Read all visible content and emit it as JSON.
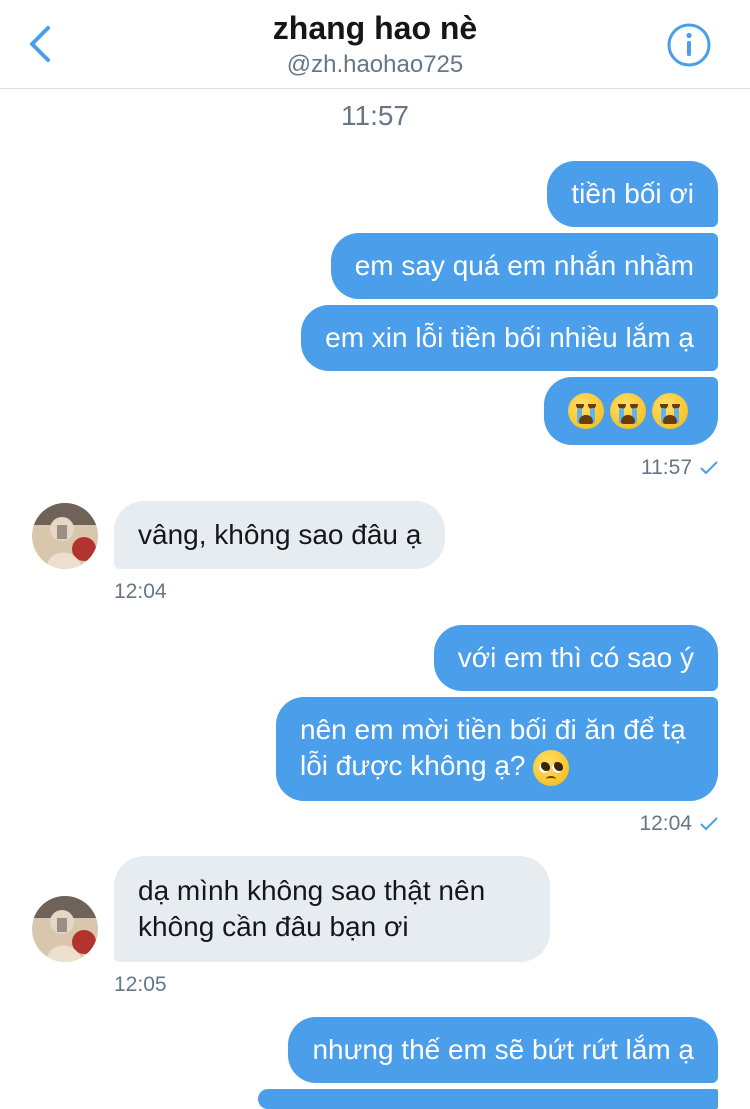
{
  "header": {
    "title": "zhang hao nè",
    "handle": "@zh.haohao725",
    "accent": "#4a9eea"
  },
  "conversation": {
    "first_timestamp": "11:57",
    "messages": [
      {
        "side": "out",
        "text": "tiền bối ơi"
      },
      {
        "side": "out",
        "text": "em say quá em nhắn nhầm"
      },
      {
        "side": "out",
        "text": "em xin lỗi tiền bối nhiều lắm ạ"
      },
      {
        "side": "out",
        "emoji": [
          "loudly-crying-face",
          "loudly-crying-face",
          "loudly-crying-face"
        ]
      },
      {
        "side": "in",
        "text": "vâng, không sao đâu ạ"
      },
      {
        "side": "out",
        "text": "với em thì có sao ý"
      },
      {
        "side": "out",
        "text": "nên em mời tiền bối đi ăn để tạ lỗi được không ạ?",
        "emoji": [
          "pleading-face"
        ]
      },
      {
        "side": "in",
        "text": "dạ mình không sao thật nên không cần đâu bạn ơi"
      },
      {
        "side": "out",
        "text": "nhưng thế em sẽ bứt rứt lắm ạ"
      }
    ],
    "meta": {
      "group1_time": "11:57",
      "group2_time": "12:04",
      "group3_time": "12:04",
      "group4_time": "12:05"
    }
  },
  "colors": {
    "outgoing_bubble": "#4a9eea",
    "incoming_bubble": "#e6ecf0",
    "secondary_text": "#657786"
  }
}
